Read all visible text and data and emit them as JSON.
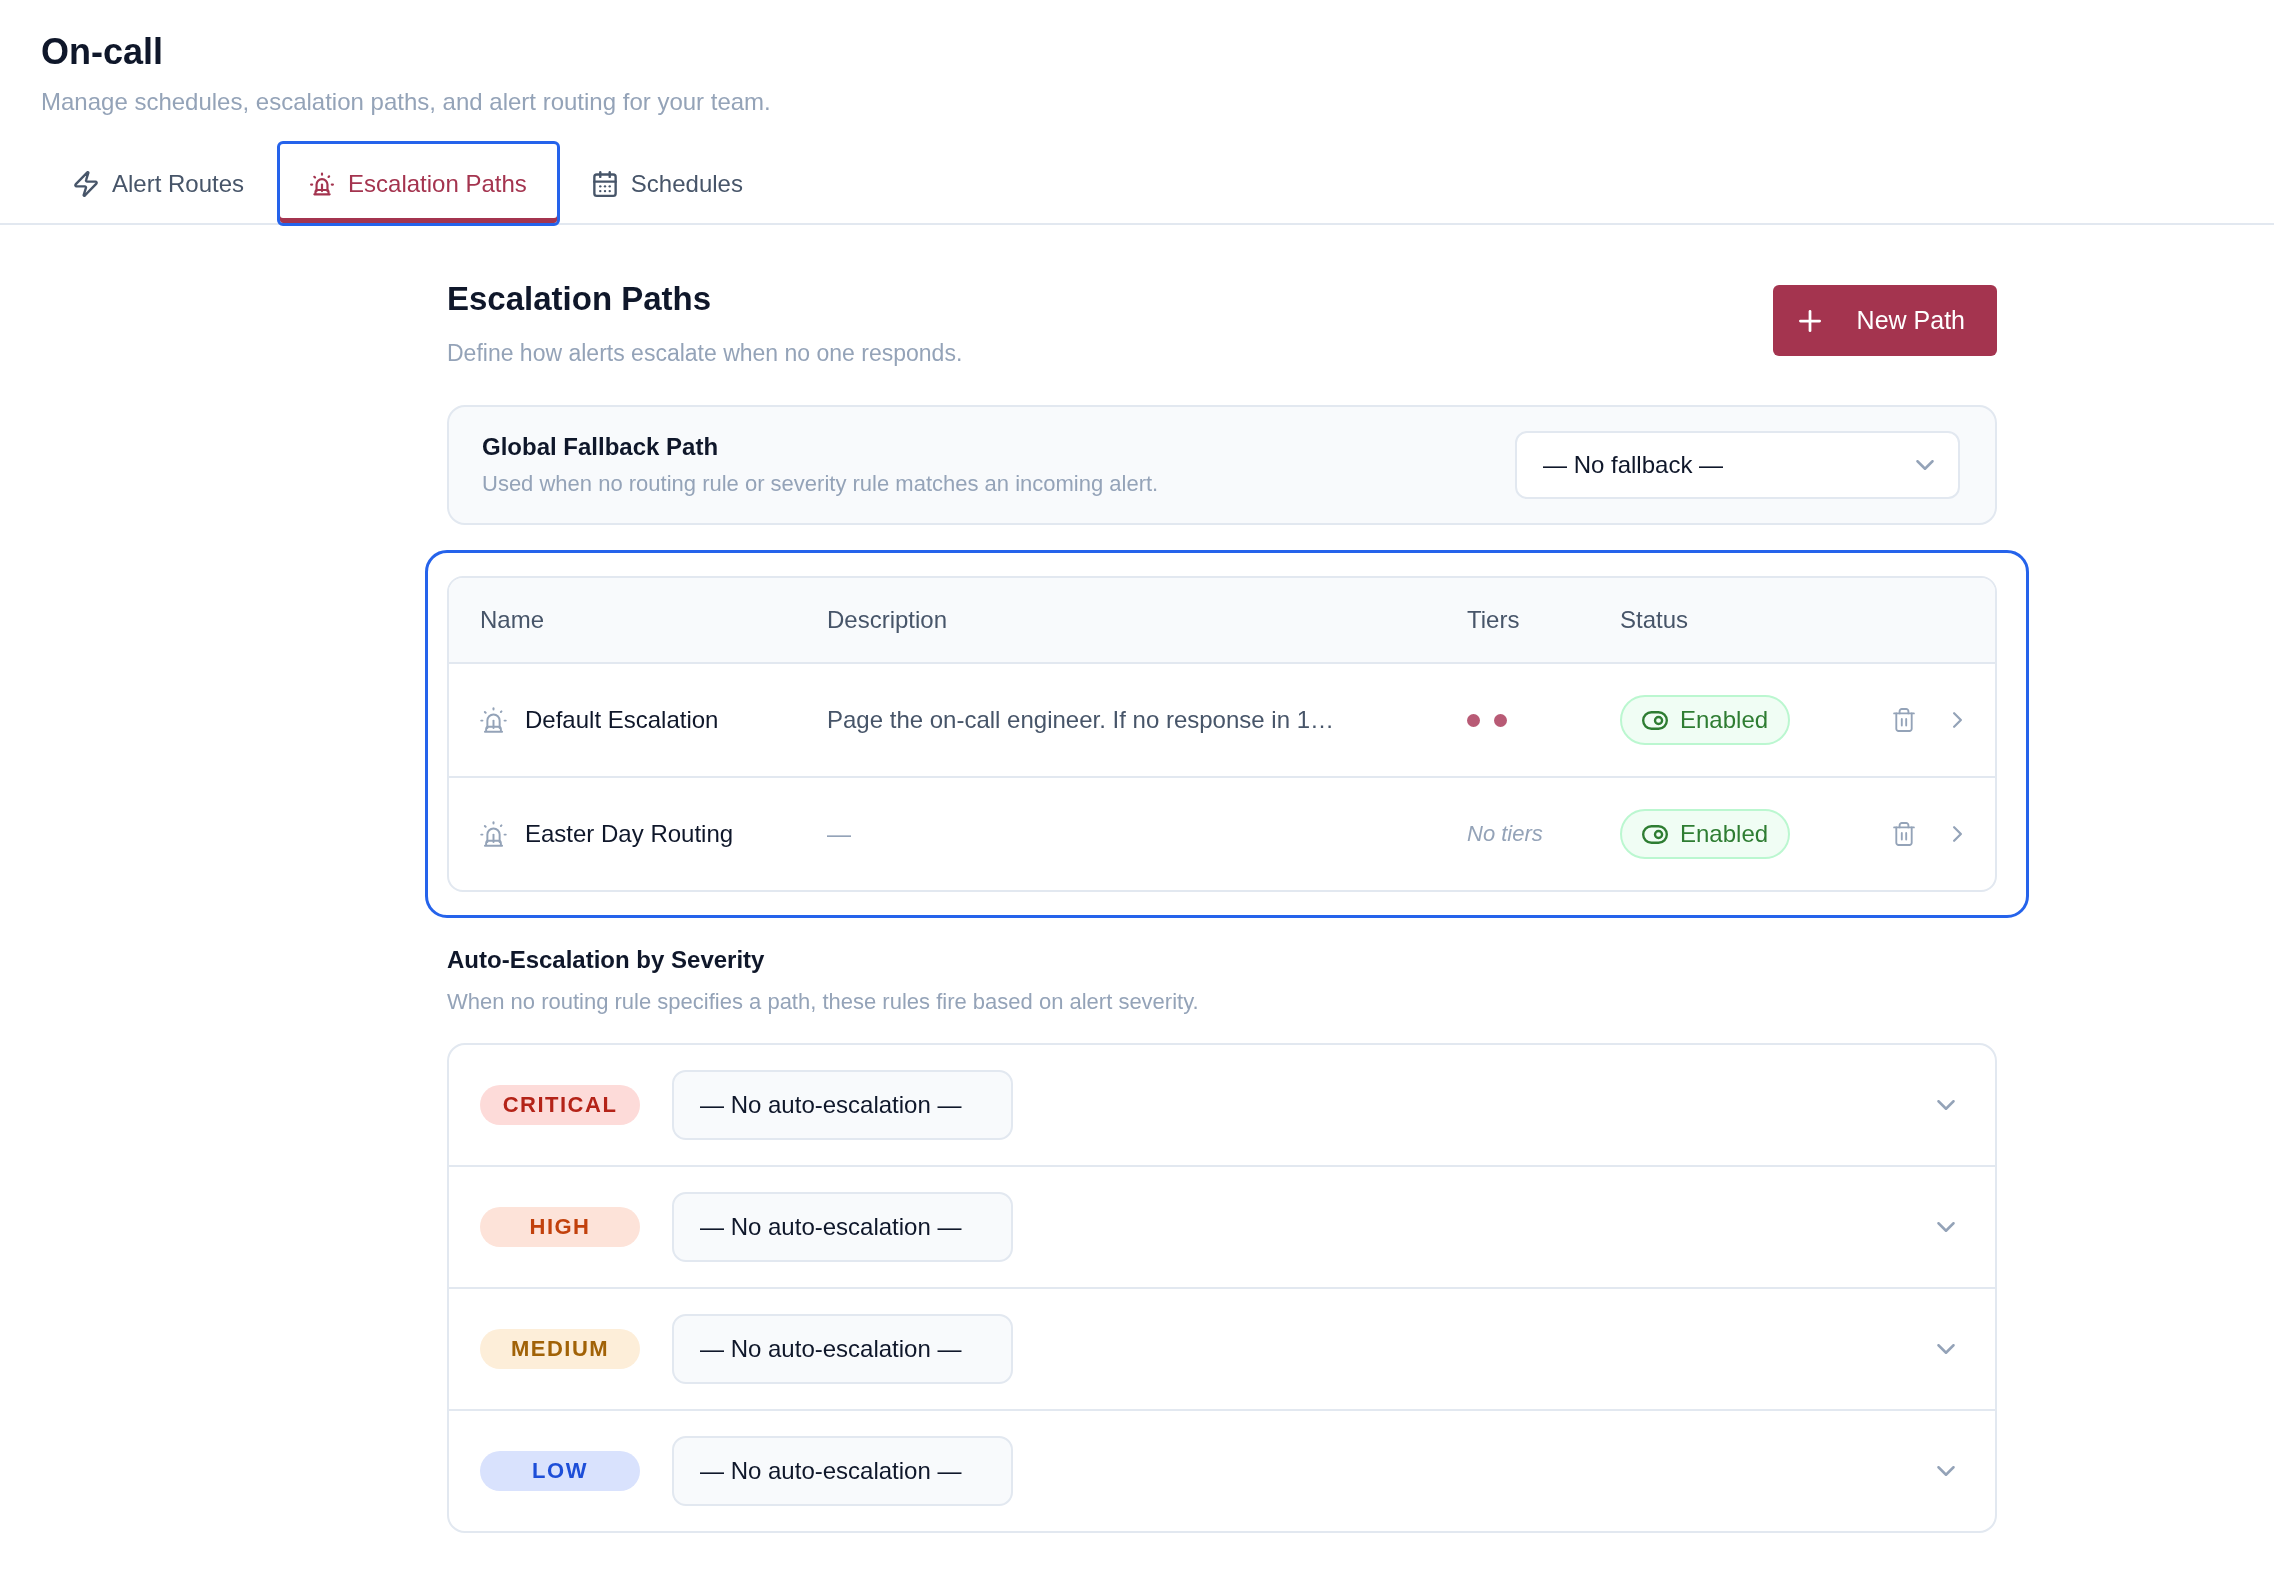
{
  "page": {
    "title": "On-call",
    "subtitle": "Manage schedules, escalation paths, and alert routing for your team."
  },
  "tabs": [
    {
      "kind": "routes",
      "label": "Alert Routes",
      "selected": false,
      "focused": false
    },
    {
      "kind": "escalation",
      "label": "Escalation Paths",
      "selected": true,
      "focused": true
    },
    {
      "kind": "schedules",
      "label": "Schedules",
      "selected": false,
      "focused": false
    }
  ],
  "section": {
    "title": "Escalation Paths",
    "description": "Define how alerts escalate when no one responds.",
    "new_button": "New Path"
  },
  "fallback": {
    "title": "Global Fallback Path",
    "description": "Used when no routing rule or severity rule matches an incoming alert.",
    "value": "— No fallback —"
  },
  "paths_table": {
    "focused": true,
    "columns": [
      "Name",
      "Description",
      "Tiers",
      "Status"
    ],
    "rows": [
      {
        "name": "Default Escalation",
        "description": "Page the on-call engineer. If no response in 1…",
        "description_muted": false,
        "tiers": [
          {
            "kind": "dot"
          },
          {
            "kind": "dot"
          }
        ],
        "status": "Enabled",
        "enabled": true
      },
      {
        "name": "Easter Day Routing",
        "description": "—",
        "description_muted": true,
        "tiers_note": "No tiers",
        "status": "Enabled",
        "enabled": true
      }
    ]
  },
  "severity": {
    "title": "Auto-Escalation by Severity",
    "description": "When no routing rule specifies a path, these rules fire based on alert severity.",
    "rules": [
      {
        "badge": "CRITICAL",
        "color": "#b42318",
        "value": "— No auto-escalation —"
      },
      {
        "badge": "HIGH",
        "color": "#c2410c",
        "value": "— No auto-escalation —"
      },
      {
        "badge": "MEDIUM",
        "color": "#a16207",
        "value": "— No auto-escalation —"
      },
      {
        "badge": "LOW",
        "color": "#1d4ed8",
        "value": "— No auto-escalation —"
      }
    ]
  }
}
